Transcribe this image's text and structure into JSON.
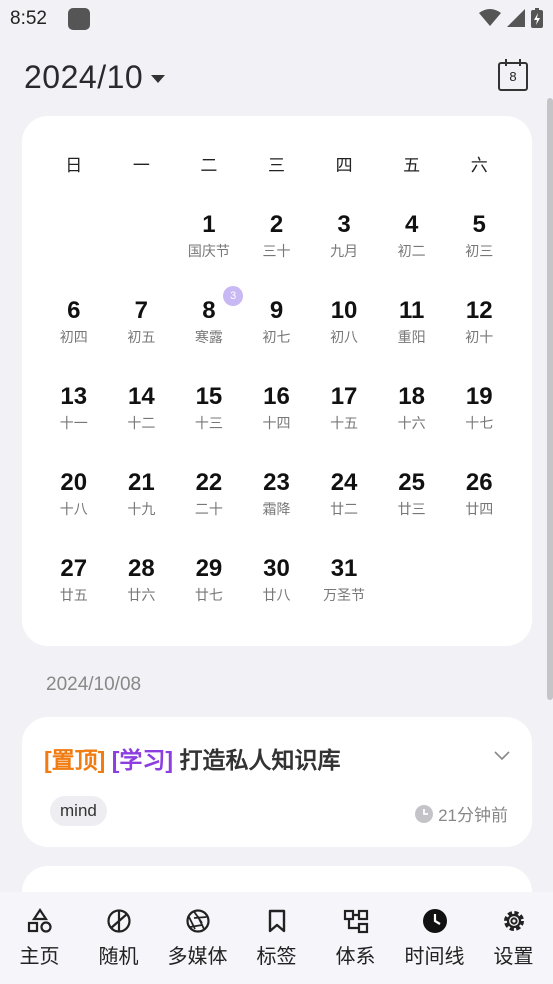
{
  "status": {
    "time": "8:52"
  },
  "header": {
    "month_title": "2024/10",
    "today_number": "8"
  },
  "calendar": {
    "weekdays": [
      "日",
      "一",
      "二",
      "三",
      "四",
      "五",
      "六"
    ],
    "leading_blanks": 2,
    "days": [
      {
        "num": "1",
        "lunar": "国庆节"
      },
      {
        "num": "2",
        "lunar": "三十"
      },
      {
        "num": "3",
        "lunar": "九月"
      },
      {
        "num": "4",
        "lunar": "初二"
      },
      {
        "num": "5",
        "lunar": "初三"
      },
      {
        "num": "6",
        "lunar": "初四"
      },
      {
        "num": "7",
        "lunar": "初五"
      },
      {
        "num": "8",
        "lunar": "寒露",
        "badge": "3"
      },
      {
        "num": "9",
        "lunar": "初七"
      },
      {
        "num": "10",
        "lunar": "初八"
      },
      {
        "num": "11",
        "lunar": "重阳"
      },
      {
        "num": "12",
        "lunar": "初十"
      },
      {
        "num": "13",
        "lunar": "十一"
      },
      {
        "num": "14",
        "lunar": "十二"
      },
      {
        "num": "15",
        "lunar": "十三"
      },
      {
        "num": "16",
        "lunar": "十四"
      },
      {
        "num": "17",
        "lunar": "十五"
      },
      {
        "num": "18",
        "lunar": "十六"
      },
      {
        "num": "19",
        "lunar": "十七"
      },
      {
        "num": "20",
        "lunar": "十八"
      },
      {
        "num": "21",
        "lunar": "十九"
      },
      {
        "num": "22",
        "lunar": "二十"
      },
      {
        "num": "23",
        "lunar": "霜降"
      },
      {
        "num": "24",
        "lunar": "廿二"
      },
      {
        "num": "25",
        "lunar": "廿三"
      },
      {
        "num": "26",
        "lunar": "廿四"
      },
      {
        "num": "27",
        "lunar": "廿五"
      },
      {
        "num": "28",
        "lunar": "廿六"
      },
      {
        "num": "29",
        "lunar": "廿七"
      },
      {
        "num": "30",
        "lunar": "廿八"
      },
      {
        "num": "31",
        "lunar": "万圣节"
      }
    ]
  },
  "date_label": "2024/10/08",
  "note": {
    "pin_tag": "[置顶]",
    "category_tag": "[学习]",
    "title": "打造私人知识库",
    "tag": "mind",
    "time_ago": "21分钟前"
  },
  "colors": {
    "pin": "#f07c12",
    "category": "#8d3ee0",
    "badge": "#c8b8f4"
  },
  "nav": [
    {
      "label": "主页",
      "icon": "shapes-icon"
    },
    {
      "label": "随机",
      "icon": "random-icon"
    },
    {
      "label": "多媒体",
      "icon": "aperture-icon"
    },
    {
      "label": "标签",
      "icon": "bookmark-icon"
    },
    {
      "label": "体系",
      "icon": "hierarchy-icon"
    },
    {
      "label": "时间线",
      "icon": "clock-icon"
    },
    {
      "label": "设置",
      "icon": "gear-icon"
    }
  ]
}
